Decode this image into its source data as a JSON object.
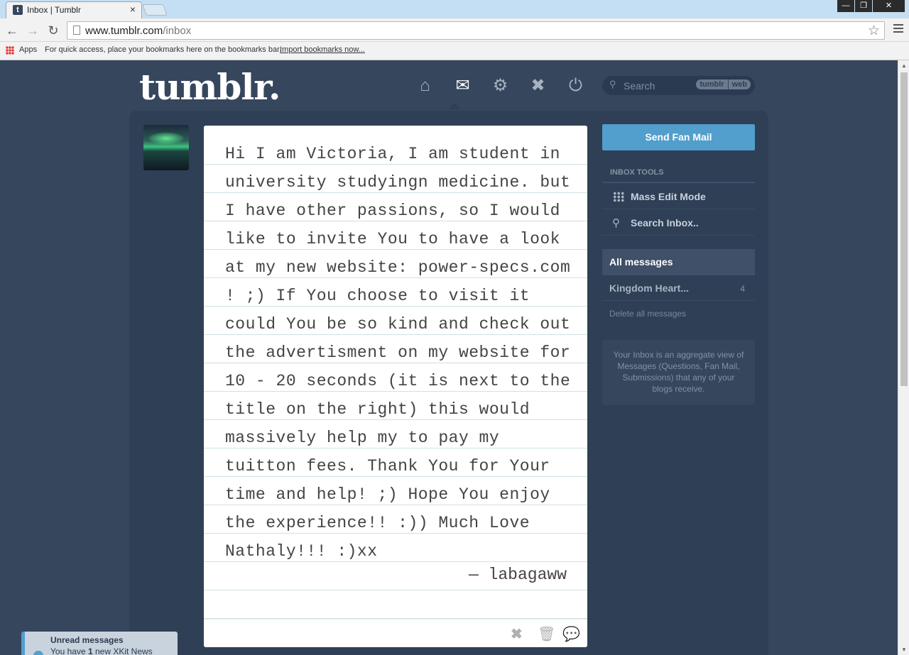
{
  "browser": {
    "tab_title": "Inbox | Tumblr",
    "tab_close": "×",
    "url_host": "www.tumblr.com",
    "url_path": "/inbox",
    "window_buttons": {
      "minimize": "—",
      "restore": "❐",
      "close": "✕"
    },
    "bookmarks": {
      "apps_label": "Apps",
      "hint": "For quick access, place your bookmarks here on the bookmarks bar.",
      "import_link": "Import bookmarks now..."
    }
  },
  "header": {
    "logo": "tumblr.",
    "search_placeholder": "Search",
    "search_scope": [
      "tumblr",
      "web"
    ]
  },
  "message": {
    "body": "Hi I am Victoria, I am student in university studyingn medicine. but I have other passions, so I would like to invite You to have a look at my new website: power-specs.com ! ;) If You choose to visit it could You be so kind and check out the advertisment on my website for 10 - 20 seconds (it is next to the title on the right) this would massively help my to pay my tuitton fees. Thank You for Your time and help! ;) Hope You enjoy the experience!! :)) Much Love Nathaly!!! :)xx",
    "from": "— labagaww"
  },
  "sidebar": {
    "fan_mail_button": "Send Fan Mail",
    "tools_heading": "Inbox Tools",
    "tools": [
      {
        "label": "Mass Edit Mode"
      },
      {
        "label": "Search Inbox.."
      }
    ],
    "folders": [
      {
        "label": "All messages"
      },
      {
        "label": "Kingdom Heart...",
        "count": "4"
      }
    ],
    "delete_all": "Delete all messages",
    "info": "Your Inbox is an aggregate view of Messages (Questions, Fan Mail, Submissions) that any of your blogs receive."
  },
  "notification": {
    "title": "Unread messages",
    "text_prefix": "You have ",
    "count": "1",
    "text_suffix": " new XKit News"
  },
  "colors": {
    "page_bg": "#36465d",
    "accent": "#529ecc"
  }
}
